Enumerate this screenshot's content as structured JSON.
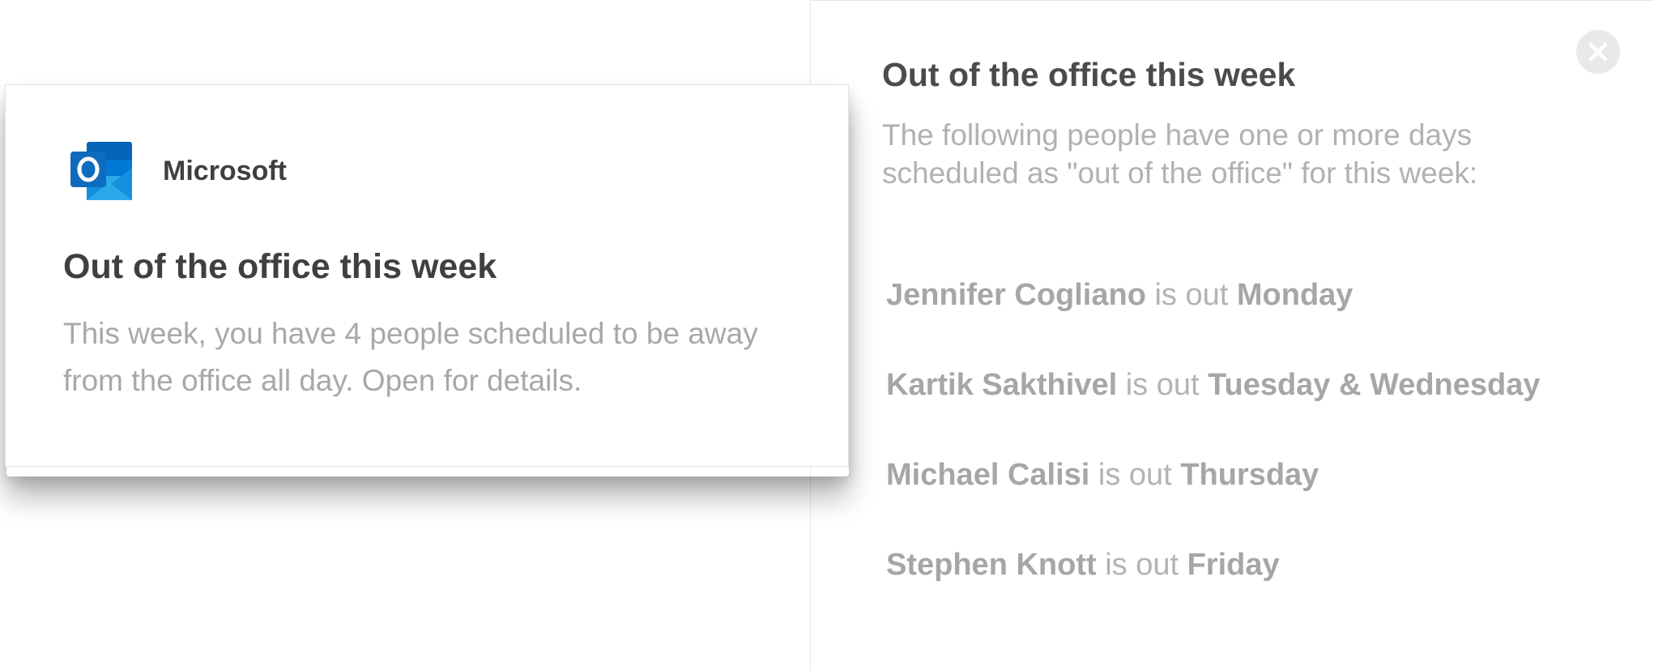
{
  "toast": {
    "app_icon": "outlook-icon",
    "app_name": "Microsoft",
    "title": "Out of the office this week",
    "body": "This week, you have 4 people scheduled to be away from the office all day. Open for details."
  },
  "detail": {
    "close_icon": "close-icon",
    "title": "Out of the office this week",
    "description": "The following people have one or more days scheduled as \"out of the office\" for this week:",
    "people": [
      {
        "name": "Jennifer Cogliano",
        "connector": " is out ",
        "days": "Monday"
      },
      {
        "name": "Kartik Sakthivel",
        "connector": " is out ",
        "days": "Tuesday & Wednesday"
      },
      {
        "name": "Michael Calisi",
        "connector": " is out ",
        "days": "Thursday"
      },
      {
        "name": "Stephen Knott",
        "connector": " is out ",
        "days": "Friday"
      }
    ]
  },
  "colors": {
    "outlook_blue": "#0f6cbd",
    "outlook_light": "#28a8ea",
    "title_text": "#3f3f3f",
    "muted_text": "#a8a8a8"
  }
}
